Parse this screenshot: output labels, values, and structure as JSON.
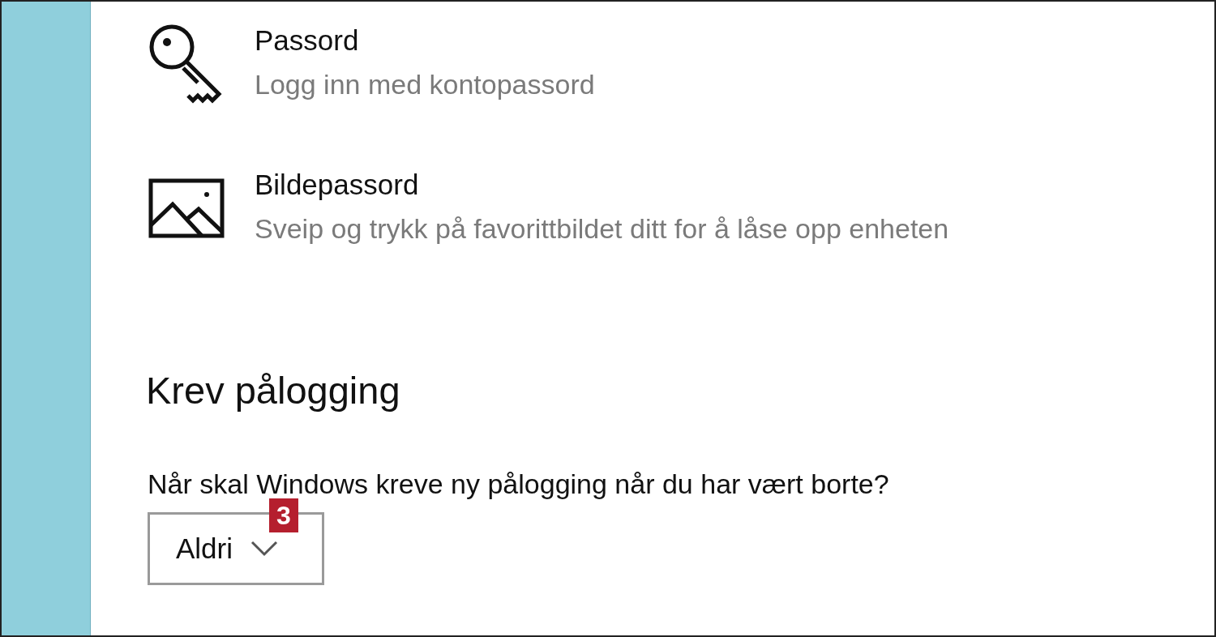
{
  "sign_in_options": [
    {
      "kind": "key",
      "title": "Passord",
      "description": "Logg inn med kontopassord"
    },
    {
      "kind": "image",
      "title": "Bildepassord",
      "description": "Sveip og trykk på favorittbildet ditt for å låse opp enheten"
    }
  ],
  "require_sign_in": {
    "heading": "Krev pålogging",
    "question": "Når skal Windows kreve ny pålogging når du har vært borte?",
    "dropdown": {
      "value": "Aldri"
    },
    "callout_badge": "3"
  }
}
